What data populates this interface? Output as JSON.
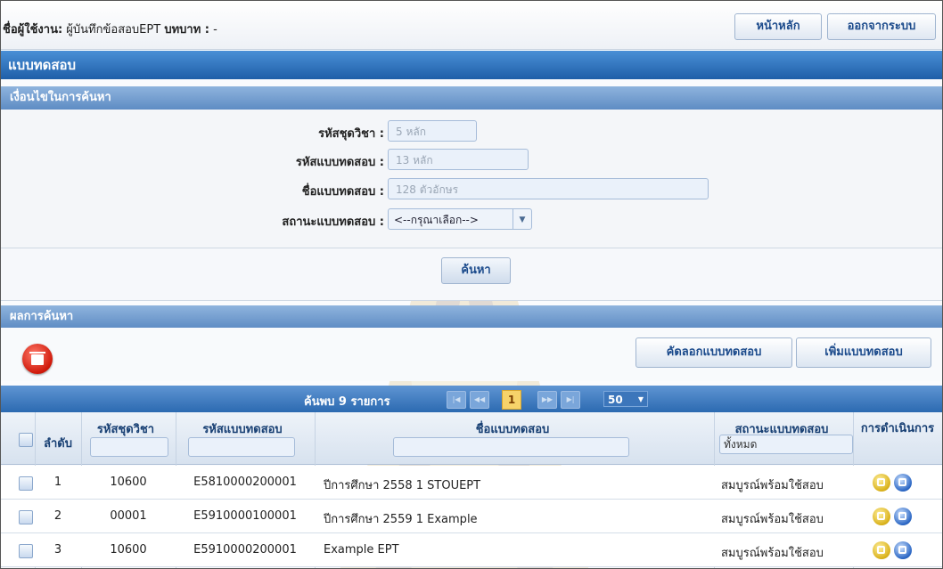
{
  "header": {
    "user_label": "ชื่อผู้ใช้งาน:",
    "user_value": "ผู้บันทึกข้อสอบEPT",
    "role_label": "บทบาท :",
    "role_value": "-",
    "home_button": "หน้าหลัก",
    "logout_button": "ออกจากระบบ"
  },
  "page_title": "แบบทดสอบ",
  "search": {
    "section_title": "เงื่อนไขในการค้นหา",
    "course_code_label": "รหัสชุดวิชา :",
    "course_code_placeholder": "5 หลัก",
    "test_code_label": "รหัสแบบทดสอบ :",
    "test_code_placeholder": "13 หลัก",
    "test_name_label": "ชื่อแบบทดสอบ :",
    "test_name_placeholder": "128 ตัวอักษร",
    "status_label": "สถานะแบบทดสอบ :",
    "status_value": "<--กรุณาเลือก-->",
    "search_button": "ค้นหา"
  },
  "results": {
    "section_title": "ผลการค้นหา",
    "copy_button": "คัดลอกแบบทดสอบ",
    "add_button": "เพิ่มแบบทดสอบ",
    "found_text": "ค้นพบ 9 รายการ",
    "current_page": "1",
    "page_size": "50",
    "columns": {
      "order": "ลำดับ",
      "course_code": "รหัสชุดวิชา",
      "test_code": "รหัสแบบทดสอบ",
      "test_name": "ชื่อแบบทดสอบ",
      "status": "สถานะแบบทดสอบ",
      "status_filter": "ทั้งหมด",
      "action": "การดำเนินการ"
    },
    "rows": [
      {
        "order": "1",
        "course_code": "10600",
        "test_code": "E5810000200001",
        "test_name": "ปีการศึกษา 2558 1 STOUEPT",
        "status": "สมบูรณ์พร้อมใช้สอบ"
      },
      {
        "order": "2",
        "course_code": "00001",
        "test_code": "E5910000100001",
        "test_name": "ปีการศึกษา 2559 1 Example",
        "status": "สมบูรณ์พร้อมใช้สอบ"
      },
      {
        "order": "3",
        "course_code": "10600",
        "test_code": "E5910000200001",
        "test_name": "Example EPT",
        "status": "สมบูรณ์พร้อมใช้สอบ"
      }
    ]
  },
  "icons": {
    "delete": "trash-icon",
    "edit": "edit-icon",
    "view": "view-icon",
    "pager_first": "first-page-icon",
    "pager_prev": "prev-page-icon",
    "pager_next": "next-page-icon",
    "pager_last": "last-page-icon"
  },
  "colors": {
    "title_bar": "#1f5fa8",
    "section_bar": "#5e8cc4",
    "delete_red": "#d0190a",
    "current_page": "#f7d36a"
  }
}
